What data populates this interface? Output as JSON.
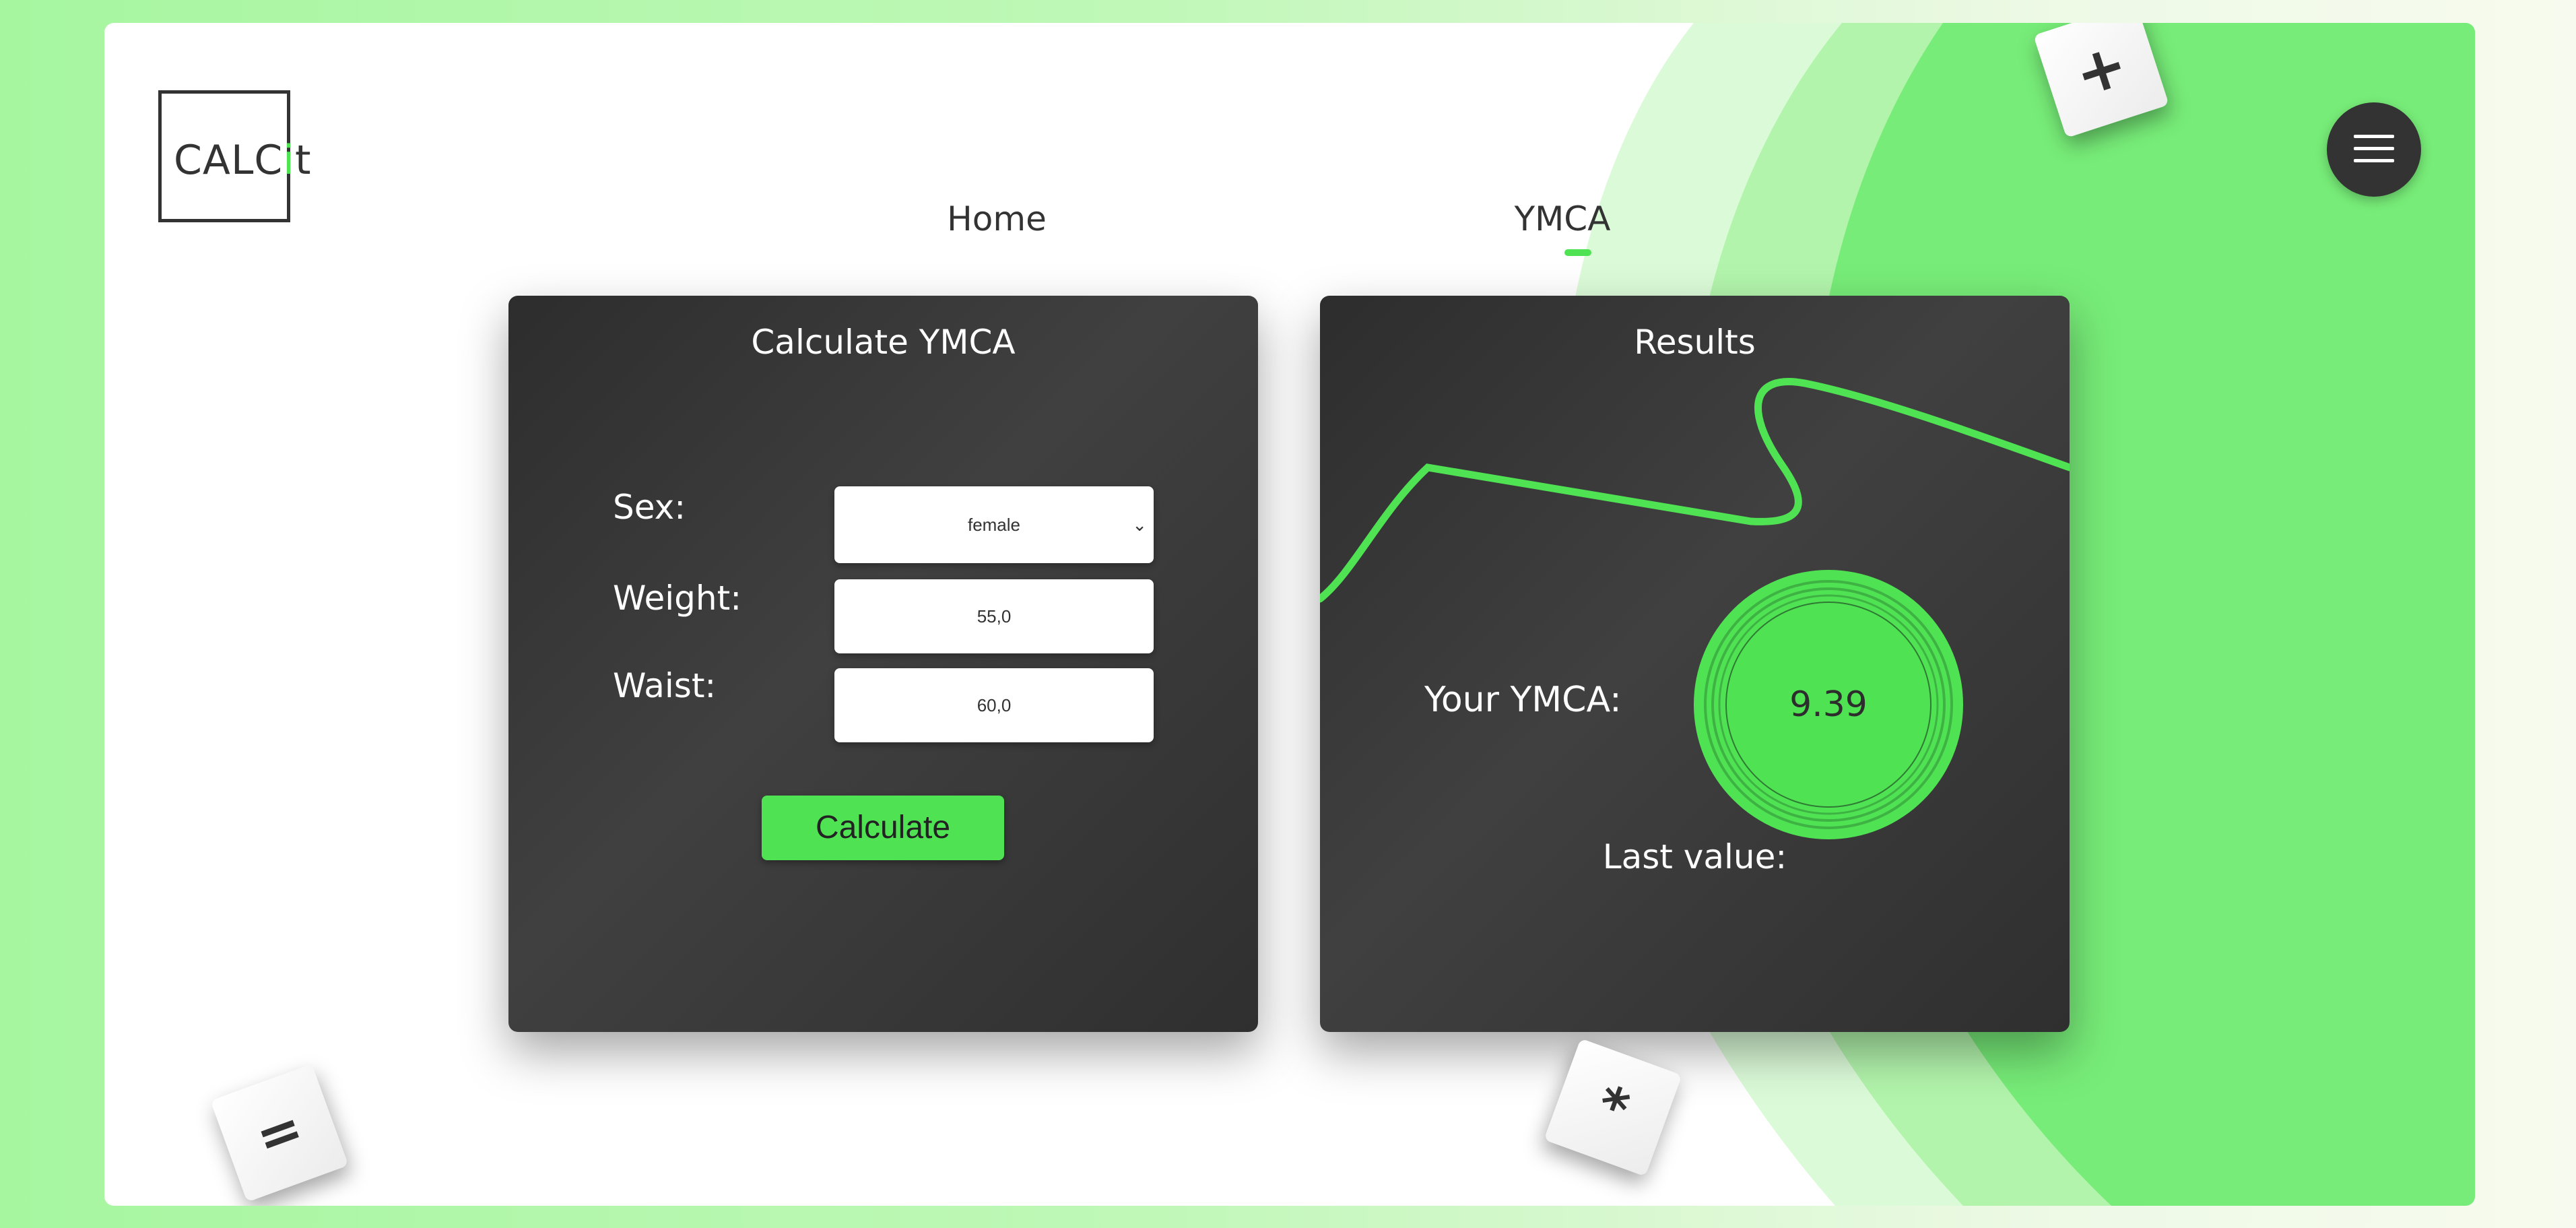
{
  "logo": {
    "text_main": "CALC",
    "text_accent": "i",
    "text_end": "t"
  },
  "nav": {
    "home": "Home",
    "ymca": "YMCA",
    "active": "YMCA"
  },
  "menu": {
    "icon": "hamburger-icon"
  },
  "calculator": {
    "title": "Calculate YMCA",
    "sex_label": "Sex:",
    "sex_value": "female",
    "weight_label": "Weight:",
    "weight_value": "55,0",
    "waist_label": "Waist:",
    "waist_value": "60,0",
    "button_label": "Calculate"
  },
  "results": {
    "title": "Results",
    "ymca_label": "Your YMCA:",
    "ymca_value": "9.39",
    "last_label": "Last value:"
  },
  "tiles": {
    "plus": "+",
    "equals": "=",
    "times": "*"
  },
  "colors": {
    "accent": "#4fe354",
    "dark": "#333333"
  }
}
